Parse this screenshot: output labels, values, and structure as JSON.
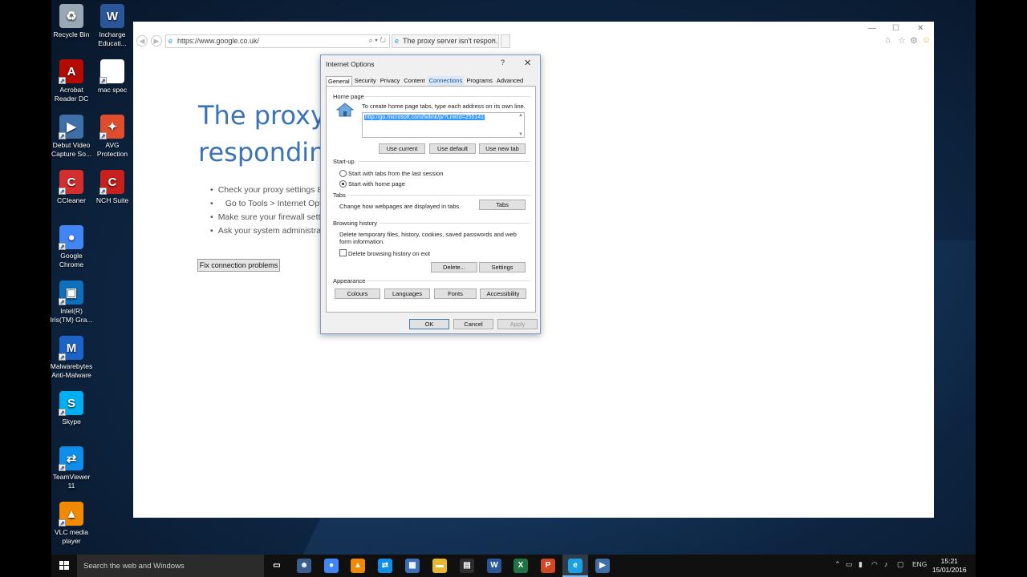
{
  "desktop": {
    "icons": [
      {
        "label": "Recycle Bin",
        "icon": "recycle-bin-icon",
        "color": "#9aa7b4",
        "glyph": "♻"
      },
      {
        "label": "Incharge Educati...",
        "icon": "word-document-icon",
        "color": "#2b579a",
        "glyph": "W"
      },
      {
        "label": "Acrobat Reader DC",
        "icon": "acrobat-icon",
        "color": "#b30b00",
        "glyph": "A"
      },
      {
        "label": "mac spec",
        "icon": "text-file-icon",
        "color": "#ffffff",
        "glyph": ""
      },
      {
        "label": "Debut Video Capture So...",
        "icon": "debut-video-icon",
        "color": "#3f6fa8",
        "glyph": "▶"
      },
      {
        "label": "AVG Protection",
        "icon": "avg-icon",
        "color": "#e04d2c",
        "glyph": "✦"
      },
      {
        "label": "CCleaner",
        "icon": "ccleaner-icon",
        "color": "#d42f2f",
        "glyph": "C"
      },
      {
        "label": "NCH Suite",
        "icon": "nch-suite-icon",
        "color": "#c8201d",
        "glyph": "C"
      },
      {
        "label": "Google Chrome",
        "icon": "chrome-icon",
        "color": "#4285f4",
        "glyph": "●"
      },
      {
        "label": "Intel(R) Iris(TM) Gra...",
        "icon": "intel-graphics-icon",
        "color": "#0f6fb8",
        "glyph": "▣"
      },
      {
        "label": "Malwarebytes Anti-Malware",
        "icon": "malwarebytes-icon",
        "color": "#1b63c6",
        "glyph": "M"
      },
      {
        "label": "Skype",
        "icon": "skype-icon",
        "color": "#00aff0",
        "glyph": "S"
      },
      {
        "label": "TeamViewer 11",
        "icon": "teamviewer-icon",
        "color": "#0e8ee9",
        "glyph": "⇄"
      },
      {
        "label": "VLC media player",
        "icon": "vlc-icon",
        "color": "#f08a00",
        "glyph": "▲"
      }
    ]
  },
  "browser": {
    "url": "https://www.google.co.uk/",
    "tab_title": "The proxy server isn't respon...",
    "title_line1": "The proxy",
    "title_line2": "responding",
    "bullets": [
      "Check your proxy settings 8",
      "Go to Tools > Internet Optio",
      "Make sure your firewall setti",
      "Ask your system administrat"
    ],
    "fix_button": "Fix connection problems"
  },
  "dialog": {
    "title": "Internet Options",
    "help": "?",
    "close": "✕",
    "tabs": [
      "General",
      "Security",
      "Privacy",
      "Content",
      "Connections",
      "Programs",
      "Advanced"
    ],
    "home_page": {
      "section": "Home page",
      "hint": "To create home page tabs, type each address on its own line.",
      "url": "http://go.microsoft.com/fwlink/p/?LinkId=255141",
      "use_current": "Use current",
      "use_default": "Use default",
      "use_new_tab": "Use new tab"
    },
    "startup": {
      "section": "Start-up",
      "option1": "Start with tabs from the last session",
      "option2": "Start with home page"
    },
    "tabs_section": {
      "section": "Tabs",
      "text": "Change how webpages are displayed in tabs.",
      "button": "Tabs"
    },
    "history": {
      "section": "Browsing history",
      "text": "Delete temporary files, history, cookies, saved passwords and web form information.",
      "checkbox": "Delete browsing history on exit",
      "delete": "Delete...",
      "settings": "Settings"
    },
    "appearance": {
      "section": "Appearance",
      "colours": "Colours",
      "languages": "Languages",
      "fonts": "Fonts",
      "accessibility": "Accessibility"
    },
    "ok": "OK",
    "cancel": "Cancel",
    "apply": "Apply"
  },
  "taskbar": {
    "search_placeholder": "Search the web and Windows",
    "apps": [
      {
        "name": "task-view-icon",
        "glyph": "▭",
        "color": "#101010"
      },
      {
        "name": "people-icon",
        "glyph": "☻",
        "color": "#3a5f8f"
      },
      {
        "name": "chrome-icon",
        "glyph": "●",
        "color": "#4285f4"
      },
      {
        "name": "vlc-icon",
        "glyph": "▲",
        "color": "#f08a00"
      },
      {
        "name": "teamviewer-icon",
        "glyph": "⇄",
        "color": "#0e8ee9"
      },
      {
        "name": "network-icon",
        "glyph": "▦",
        "color": "#3b6fb6"
      },
      {
        "name": "file-explorer-icon",
        "glyph": "▬",
        "color": "#e8b830"
      },
      {
        "name": "store-icon",
        "glyph": "▤",
        "color": "#2d2d2d"
      },
      {
        "name": "word-icon",
        "glyph": "W",
        "color": "#2b579a"
      },
      {
        "name": "excel-icon",
        "glyph": "X",
        "color": "#217346"
      },
      {
        "name": "powerpoint-icon",
        "glyph": "P",
        "color": "#d24726"
      },
      {
        "name": "internet-explorer-icon",
        "glyph": "e",
        "color": "#1ba1e2"
      },
      {
        "name": "debut-icon",
        "glyph": "▶",
        "color": "#3f6fa8"
      }
    ],
    "language": "ENG",
    "time": "15:21",
    "date": "15/01/2016"
  }
}
